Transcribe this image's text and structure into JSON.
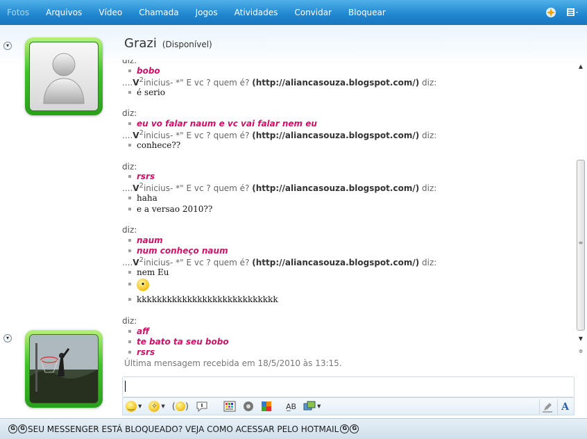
{
  "menu": {
    "items": [
      "Fotos",
      "Arquivos",
      "Vídeo",
      "Chamada",
      "Jogos",
      "Atividades",
      "Convidar",
      "Bloquear"
    ]
  },
  "icons": {
    "games": "sparkle-icon",
    "options": "menu-icon",
    "collapse": "chevron-down-icon",
    "emoticon": "smiley-icon",
    "wink": "wink-icon",
    "nudge": "nudge-icon",
    "voice": "voice-clip-icon",
    "backgrounds": "backgrounds-icon",
    "sound": "sound-icon",
    "ink": "ink-icon",
    "handwriting": "handwriting-icon",
    "font": "font-icon"
  },
  "contact": {
    "name": "Grazi",
    "status": "(Disponível)"
  },
  "sender_header": {
    "prefix": "....",
    "name_bold": "V",
    "sup": "2",
    "name_rest": "inicius- *\" E vc ? quem é? ",
    "link": "(http://aliancasouza.blogspot.com/)",
    "suffix": " diz:"
  },
  "history": {
    "diz": "diz:",
    "group1_pink": [
      "bobo"
    ],
    "group1_plain": [
      "é serio"
    ],
    "group2_pink": [
      "eu vo falar naum e vc vai falar nem eu"
    ],
    "group2_plain": [
      "conhece??"
    ],
    "group3_pink": [
      "rsrs"
    ],
    "group3_plain": [
      "haha",
      "e a versao 2010??"
    ],
    "group4_pink": [
      "naum",
      "num conheço naum"
    ],
    "group4_plain": [
      "nem Eu",
      "",
      "kkkkkkkkkkkkkkkkkkkkkkkkkkkk"
    ],
    "group5_pink": [
      "aff",
      "te bato ta seu bobo",
      "rsrs"
    ]
  },
  "last_message": "Última mensagem recebida em 18/5/2010 às 13:15.",
  "input": {
    "value": ""
  },
  "banner": {
    "text": "SEU MESSENGER ESTÁ BLOQUEADO? VEJA COMO ACESSAR PELO HOTMAIL"
  },
  "colors": {
    "menubar": "#1f86cf",
    "pink_text": "#cc1166",
    "avatar_green": "#3fc22a"
  }
}
